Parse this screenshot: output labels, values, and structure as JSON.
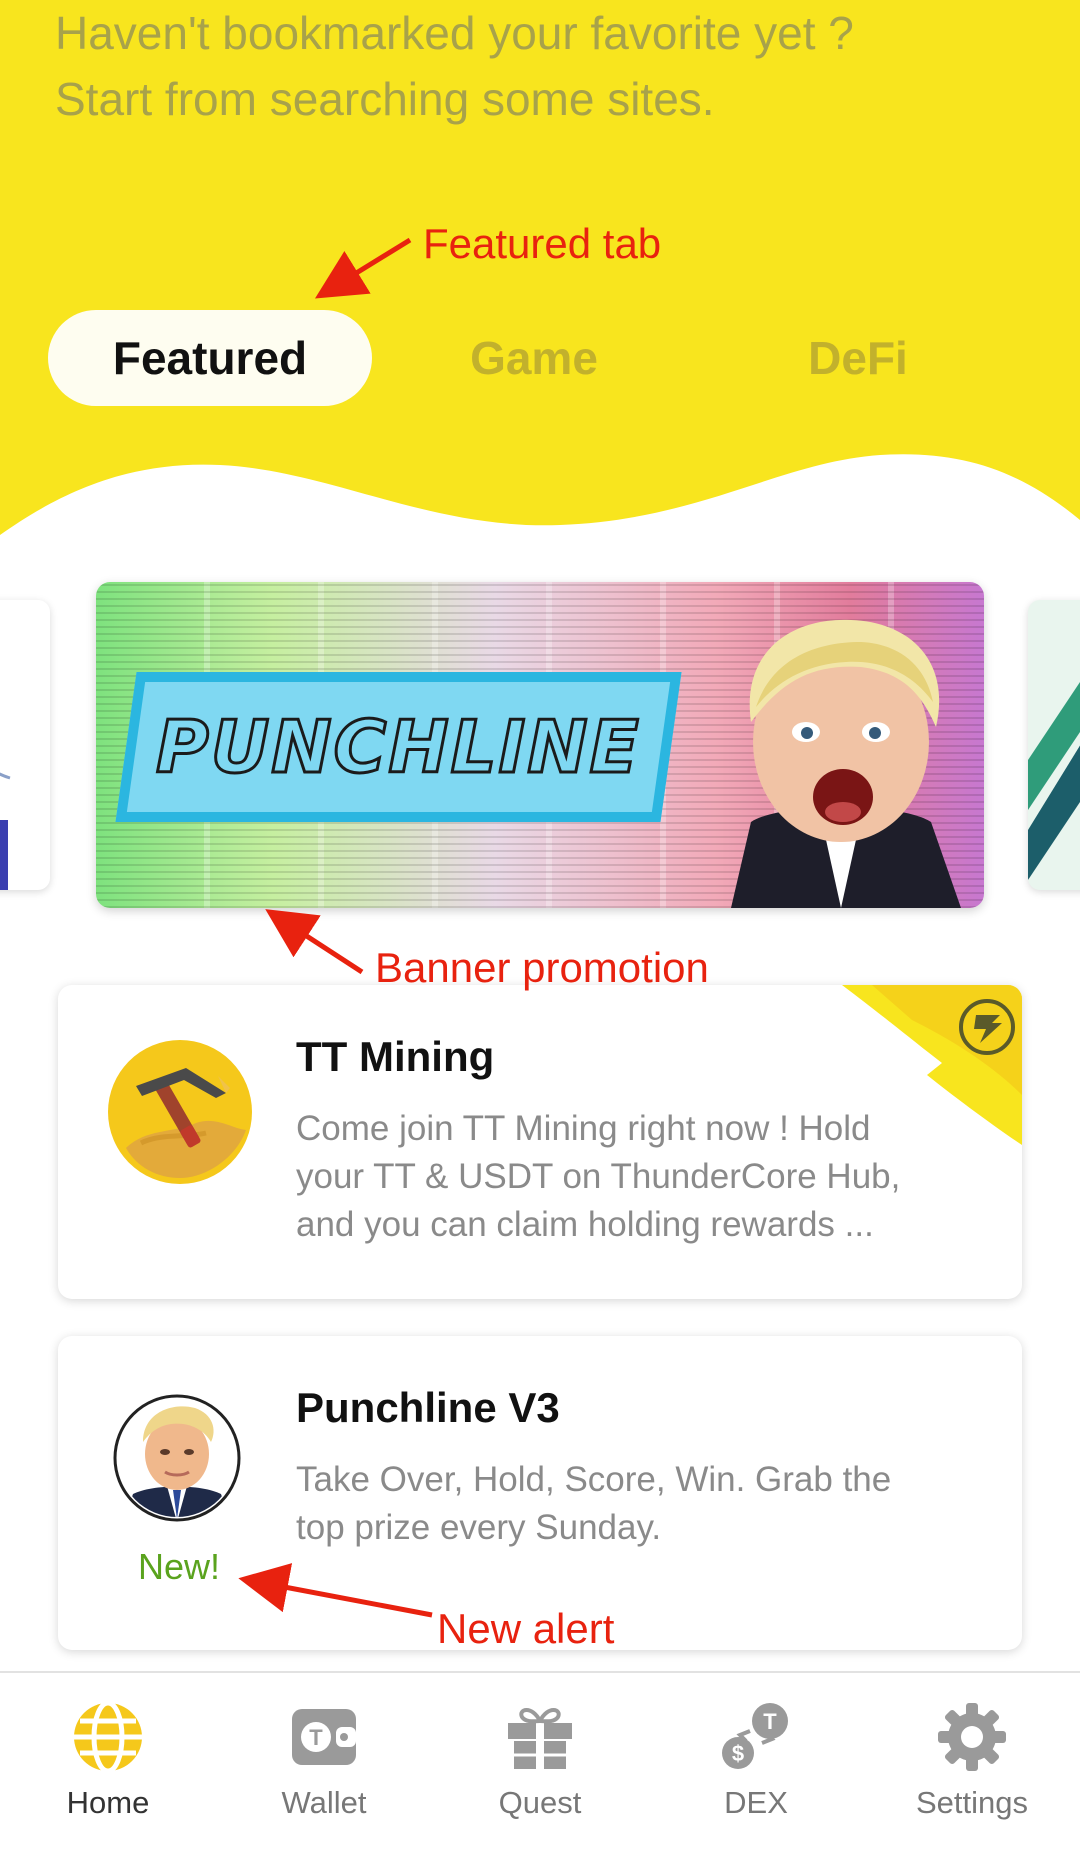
{
  "empty_hint": {
    "line1": "Haven't bookmarked your favorite yet ?",
    "line2": "Start from searching some sites."
  },
  "annotations": {
    "featured_tab": "Featured tab",
    "banner_promotion": "Banner promotion",
    "new_alert": "New alert"
  },
  "tabs": [
    {
      "label": "Featured",
      "active": true
    },
    {
      "label": "Game",
      "active": false
    },
    {
      "label": "DeFi",
      "active": false
    }
  ],
  "banner": {
    "title": "PUNCHLINE"
  },
  "cards": [
    {
      "title": "TT Mining",
      "description": "Come join TT Mining right now ! Hold your TT & USDT on ThunderCore Hub, and you can claim holding rewards ...",
      "icon": "pickaxe-icon"
    },
    {
      "title": "Punchline V3",
      "description": "Take Over, Hold, Score, Win. Grab the top prize every Sunday.",
      "icon": "portrait-avatar",
      "badge": "New!"
    }
  ],
  "bottom_nav": [
    {
      "label": "Home",
      "icon": "globe-icon",
      "active": true
    },
    {
      "label": "Wallet",
      "icon": "wallet-icon",
      "active": false
    },
    {
      "label": "Quest",
      "icon": "gift-icon",
      "active": false
    },
    {
      "label": "DEX",
      "icon": "dex-swap-icon",
      "active": false
    },
    {
      "label": "Settings",
      "icon": "gear-icon",
      "active": false
    }
  ],
  "colors": {
    "header_yellow": "#f8e51e",
    "accent_yellow": "#f5c81b",
    "annotation_red": "#e8220f",
    "new_green": "#5aa31e"
  }
}
